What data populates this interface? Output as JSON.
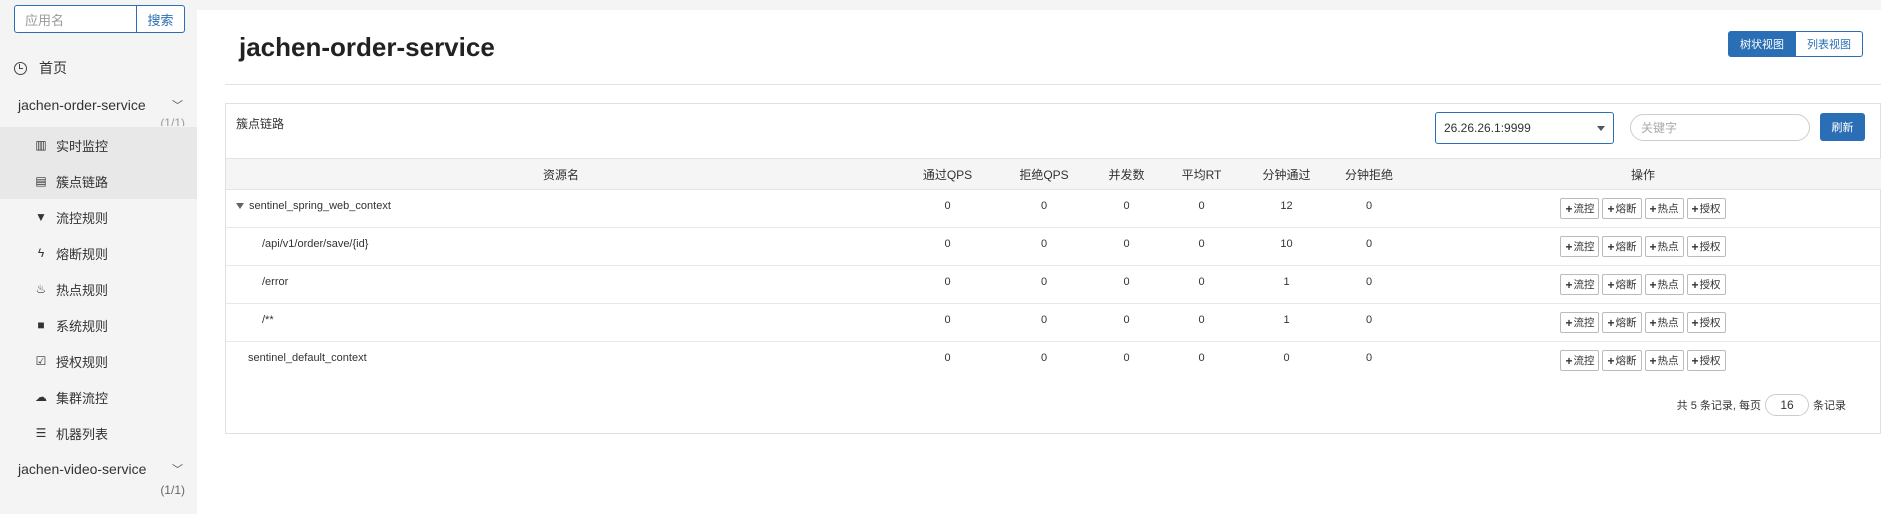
{
  "sidebar": {
    "search_placeholder": "应用名",
    "search_button": "搜索",
    "home_label": "首页",
    "apps": [
      {
        "name": "jachen-order-service",
        "count": "(1/1)",
        "expanded": true
      },
      {
        "name": "jachen-video-service",
        "count": "(1/1)",
        "expanded": false
      }
    ],
    "menu": [
      {
        "label": "实时监控",
        "icon": "bar-chart-icon",
        "glyph": "▥",
        "selected": true
      },
      {
        "label": "簇点链路",
        "icon": "list-alt-icon",
        "glyph": "▤",
        "selected": true
      },
      {
        "label": "流控规则",
        "icon": "filter-icon",
        "glyph": "▼",
        "selected": false
      },
      {
        "label": "熔断规则",
        "icon": "flash-icon",
        "glyph": "ϟ",
        "selected": false
      },
      {
        "label": "热点规则",
        "icon": "fire-icon",
        "glyph": "♨",
        "selected": false
      },
      {
        "label": "系统规则",
        "icon": "lock-icon",
        "glyph": "■",
        "selected": false
      },
      {
        "label": "授权规则",
        "icon": "check-icon",
        "glyph": "☑",
        "selected": false
      },
      {
        "label": "集群流控",
        "icon": "cloud-icon",
        "glyph": "☁",
        "selected": false
      },
      {
        "label": "机器列表",
        "icon": "th-list-icon",
        "glyph": "☰",
        "selected": false
      }
    ]
  },
  "header": {
    "title": "jachen-order-service",
    "view_tree": "树状视图",
    "view_list": "列表视图"
  },
  "panel": {
    "title": "簇点链路",
    "machine": "26.26.26.1:9999",
    "keyword_placeholder": "关键字",
    "refresh": "刷新"
  },
  "table": {
    "columns": [
      "资源名",
      "通过QPS",
      "拒绝QPS",
      "并发数",
      "平均RT",
      "分钟通过",
      "分钟拒绝",
      "操作"
    ],
    "rows": [
      {
        "name": "sentinel_spring_web_context",
        "level": 0,
        "expandable": true,
        "pass_qps": "0",
        "block_qps": "0",
        "concurrency": "0",
        "avg_rt": "0",
        "min_pass": "12",
        "min_block": "0"
      },
      {
        "name": "/api/v1/order/save/{id}",
        "level": 1,
        "expandable": false,
        "pass_qps": "0",
        "block_qps": "0",
        "concurrency": "0",
        "avg_rt": "0",
        "min_pass": "10",
        "min_block": "0"
      },
      {
        "name": "/error",
        "level": 1,
        "expandable": false,
        "pass_qps": "0",
        "block_qps": "0",
        "concurrency": "0",
        "avg_rt": "0",
        "min_pass": "1",
        "min_block": "0"
      },
      {
        "name": "/**",
        "level": 1,
        "expandable": false,
        "pass_qps": "0",
        "block_qps": "0",
        "concurrency": "0",
        "avg_rt": "0",
        "min_pass": "1",
        "min_block": "0"
      },
      {
        "name": "sentinel_default_context",
        "level": 0,
        "expandable": false,
        "pass_qps": "0",
        "block_qps": "0",
        "concurrency": "0",
        "avg_rt": "0",
        "min_pass": "0",
        "min_block": "0"
      }
    ],
    "actions": [
      "流控",
      "熔断",
      "热点",
      "授权"
    ]
  },
  "pagination": {
    "prefix": "共 5 条记录, 每页",
    "page_size": "16",
    "suffix": "条记录"
  },
  "colors": {
    "accent": "#2a6fb5"
  }
}
